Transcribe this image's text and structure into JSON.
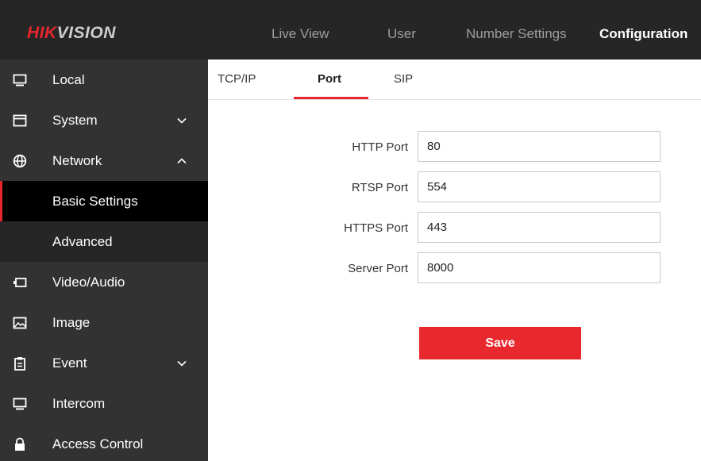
{
  "brand": {
    "part1": "HIK",
    "part2": "VISION"
  },
  "nav": [
    {
      "label": "Live View",
      "active": false
    },
    {
      "label": "User",
      "active": false
    },
    {
      "label": "Number Settings",
      "active": false
    },
    {
      "label": "Configuration",
      "active": true
    }
  ],
  "sidebar": {
    "items": [
      {
        "label": "Local",
        "icon": "monitor-icon"
      },
      {
        "label": "System",
        "icon": "window-icon",
        "chevron": "down"
      },
      {
        "label": "Network",
        "icon": "globe-icon",
        "chevron": "up"
      },
      {
        "label": "Basic Settings",
        "sub": true,
        "selected": true
      },
      {
        "label": "Advanced",
        "sub": true
      },
      {
        "label": "Video/Audio",
        "icon": "camera-icon"
      },
      {
        "label": "Image",
        "icon": "image-icon"
      },
      {
        "label": "Event",
        "icon": "clipboard-icon",
        "chevron": "down"
      },
      {
        "label": "Intercom",
        "icon": "monitor-icon"
      },
      {
        "label": "Access Control",
        "icon": "lock-icon"
      }
    ]
  },
  "tabs": [
    {
      "label": "TCP/IP",
      "active": false
    },
    {
      "label": "Port",
      "active": true
    },
    {
      "label": "SIP",
      "active": false
    }
  ],
  "form": {
    "http": {
      "label": "HTTP Port",
      "value": "80"
    },
    "rtsp": {
      "label": "RTSP Port",
      "value": "554"
    },
    "https": {
      "label": "HTTPS Port",
      "value": "443"
    },
    "server": {
      "label": "Server Port",
      "value": "8000"
    }
  },
  "save_label": "Save",
  "colors": {
    "accent": "#e5262c",
    "header": "#262626",
    "sidebar": "#323232"
  }
}
